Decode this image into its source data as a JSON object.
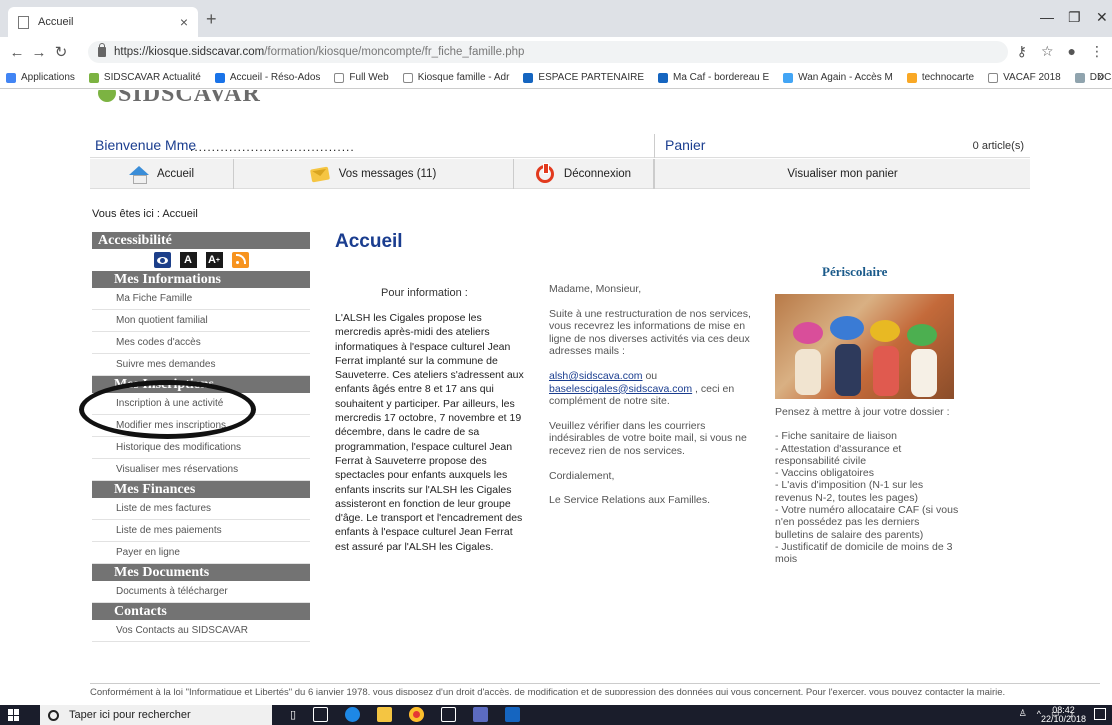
{
  "browser": {
    "tab_title": "Accueil",
    "tab_close": "×",
    "new_tab": "+",
    "url_host": "https://kiosque.sidscavar.com",
    "url_path": "/formation/kiosque/moncompte/fr_fiche_famille.php",
    "bookmarks": [
      {
        "label": "Applications",
        "color": "#4285f4"
      },
      {
        "label": "SIDSCAVAR Actualité",
        "color": "#7cb342"
      },
      {
        "label": "Accueil - Réso-Ados",
        "color": "#1a73e8"
      },
      {
        "label": "Full Web",
        "color": "#ffffff"
      },
      {
        "label": "Kiosque famille - Adr",
        "color": "#ffffff"
      },
      {
        "label": "ESPACE PARTENAIRE",
        "color": "#1565c0"
      },
      {
        "label": "Ma Caf - bordereau E",
        "color": "#1565c0"
      },
      {
        "label": "Wan Again - Accès M",
        "color": "#42a5f5"
      },
      {
        "label": "technocarte",
        "color": "#f9a825"
      },
      {
        "label": "VACAF 2018",
        "color": "#ffffff"
      },
      {
        "label": "DDCS",
        "color": "#90a4ae"
      }
    ],
    "bookmarks_more": "»"
  },
  "site": {
    "logo_text": "SIDSCAVAR"
  },
  "header": {
    "welcome": "Bienvenue Mme",
    "dots": "......................................",
    "panier": "Panier",
    "articles": "0 article(s)"
  },
  "menu": {
    "home": "Accueil",
    "messages": "Vos messages (11)",
    "logout": "Déconnexion",
    "cart": "Visualiser mon panier"
  },
  "breadcrumb": "Vous êtes ici : Accueil",
  "sidebar": {
    "accessibility": "Accessibilité",
    "acc_icons": [
      "A",
      "A",
      "+"
    ],
    "sections": [
      {
        "title": "Mes Informations",
        "items": [
          "Ma Fiche Famille",
          "Mon quotient familial",
          "Mes codes d'accès",
          "Suivre mes demandes"
        ]
      },
      {
        "title": "Mes Inscriptions",
        "items": [
          "Inscription à une activité",
          "Modifier mes inscriptions",
          "Historique des modifications",
          "Visualiser mes réservations"
        ]
      },
      {
        "title": "Mes Finances",
        "items": [
          "Liste de mes factures",
          "Liste de mes paiements",
          "Payer en ligne"
        ]
      },
      {
        "title": "Mes Documents",
        "items": [
          "Documents à télécharger"
        ]
      },
      {
        "title": "Contacts",
        "items": [
          "Vos Contacts au SIDSCAVAR"
        ]
      }
    ]
  },
  "main": {
    "title": "Accueil",
    "col1_head": "Pour information :",
    "col1_text": "L'ALSH les Cigales propose les mercredis après-midi des ateliers informatiques à l'espace culturel Jean Ferrat implanté sur la commune de Sauveterre. Ces ateliers s'adressent aux enfants âgés entre 8 et 17 ans qui souhaitent y participer. Par ailleurs, les mercredis 17 octobre, 7 novembre et 19 décembre, dans le cadre de sa programmation, l'espace culturel Jean Ferrat à Sauveterre propose des spectacles pour enfants auxquels les enfants inscrits sur l'ALSH les Cigales assisteront en fonction de leur groupe d'âge. Le transport et l'encadrement des enfants à l'espace culturel Jean Ferrat est assuré par l'ALSH les Cigales.",
    "col2": {
      "greeting": "Madame, Monsieur,",
      "p1": "Suite à une restructuration de nos services, vous recevrez les informations de mise en ligne de nos diverses activités via ces deux adresses mails :",
      "email1": "alsh@sidscava.com",
      "or": " ou ",
      "email2": "baselescigales@sidscava.com",
      "p2_tail": " , ceci en complément de notre site.",
      "p3": "Veuillez vérifier dans les courriers indésirables de votre boite mail, si vous ne recevez rien de nos services.",
      "p4": "Cordialement,",
      "p5": "Le Service Relations aux Familles."
    },
    "col3": {
      "title": "Périscolaire",
      "intro": "Pensez à mettre à jour votre dossier :",
      "items": [
        "- Fiche sanitaire de liaison",
        "- Attestation d'assurance et responsabilité civile",
        "- Vaccins obligatoires",
        "- L'avis d'imposition (N-1 sur les revenus N-2, toutes les pages)",
        "- Votre numéro allocataire CAF (si vous n'en possédez pas les derniers bulletins de salaire des parents)",
        "- Justificatif de domicile de moins de 3 mois"
      ]
    }
  },
  "footer": "Conformément à la loi \"Informatique et Libertés\" du 6 janvier 1978, vous disposez d'un droit d'accès, de modification et de suppression des données qui vous concernent. Pour l'exercer, vous pouvez contacter la mairie.",
  "taskbar": {
    "search_placeholder": "Taper ici pour rechercher",
    "time": "08:42",
    "date": "22/10/2018"
  }
}
